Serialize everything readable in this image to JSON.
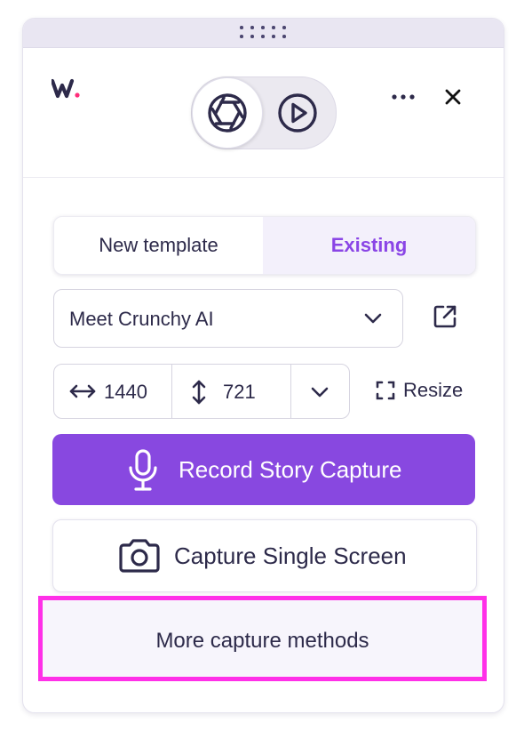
{
  "header": {
    "logo_text": "w.",
    "modes": [
      {
        "name": "screenshot",
        "icon": "aperture-icon",
        "active": true
      },
      {
        "name": "video",
        "icon": "play-circle-icon",
        "active": false
      }
    ],
    "more_icon": "more-horizontal-icon",
    "close_icon": "close-icon"
  },
  "template_tabs": {
    "new_label": "New template",
    "existing_label": "Existing",
    "active": "existing"
  },
  "template_select": {
    "value": "Meet Crunchy AI",
    "open_icon": "external-link-icon"
  },
  "dimensions": {
    "width": "1440",
    "height": "721",
    "resize_label": "Resize"
  },
  "actions": {
    "record_label": "Record Story Capture",
    "single_label": "Capture Single Screen",
    "more_label": "More capture methods"
  },
  "colors": {
    "accent": "#8848e0",
    "accent_text": "#8a45e6",
    "highlight": "#ff30e8",
    "logo_dot": "#ff2d7a"
  }
}
